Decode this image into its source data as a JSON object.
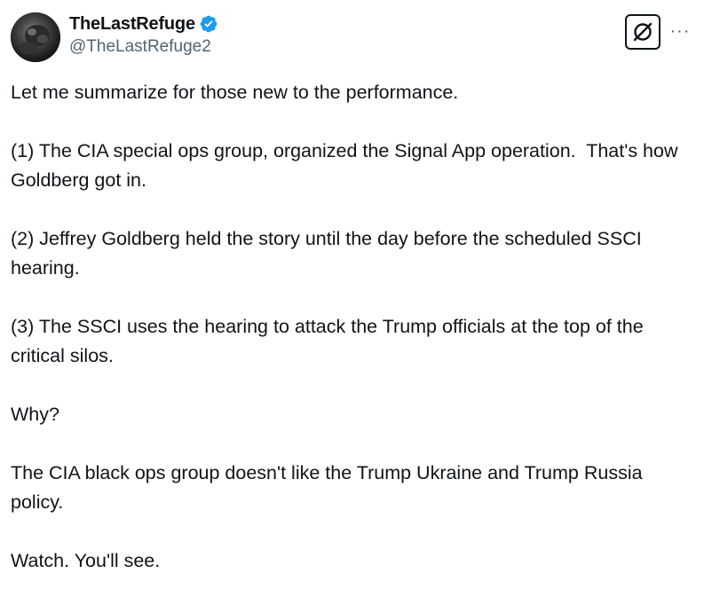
{
  "author": {
    "display_name": "TheLastRefuge",
    "handle": "@TheLastRefuge2",
    "verified": true,
    "verified_color": "#1d9bf0"
  },
  "actions": {
    "grok_icon": "grok-icon",
    "more_label": "···"
  },
  "tweet": {
    "paragraphs": [
      "Let me summarize for those new to the performance.",
      "(1) The CIA special ops group, organized the Signal App operation.  That's how Goldberg got in.",
      "(2) Jeffrey Goldberg held the story until the day before the scheduled SSCI hearing.",
      "(3) The SSCI uses the hearing to attack the Trump officials at the top of the critical silos.",
      "Why?",
      "The CIA black ops group doesn't like the Trump Ukraine and Trump Russia policy.",
      "Watch. You'll see."
    ]
  }
}
